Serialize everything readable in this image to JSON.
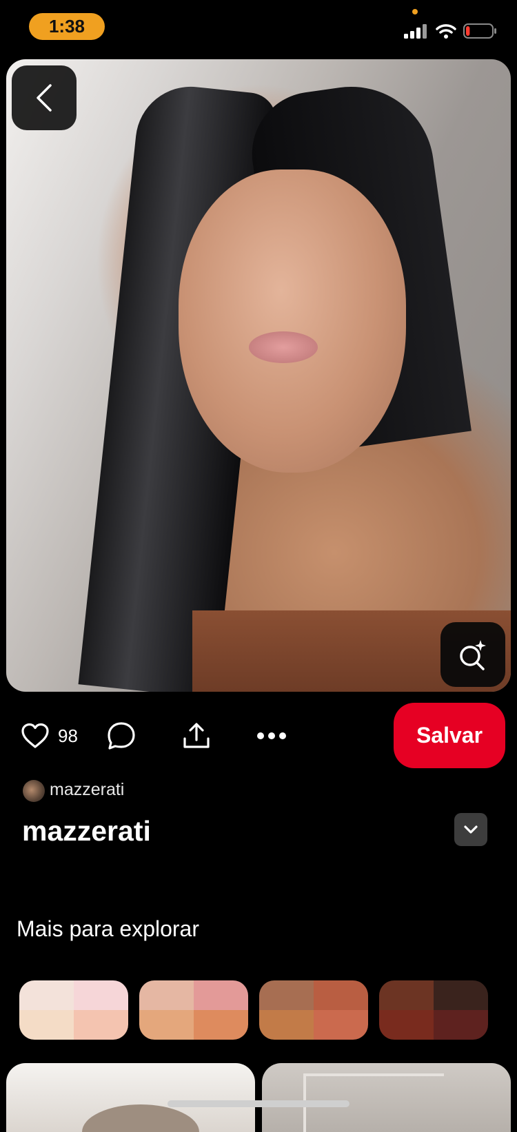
{
  "status_bar": {
    "time": "1:38",
    "battery_level_percent": 15
  },
  "pin": {
    "like_count": "98",
    "save_label": "Salvar",
    "author_small": "mazzerati",
    "title": "mazzerati"
  },
  "icons": {
    "back": "chevron-left-icon",
    "visual_search": "lens-sparkle-icon",
    "like": "heart-outline-icon",
    "comment": "comment-bubble-icon",
    "share": "share-upload-icon",
    "more": "ellipsis-icon",
    "expand": "chevron-down-icon"
  },
  "explore": {
    "title": "Mais para explorar",
    "palettes": [
      [
        "#f3e2da",
        "#f6d6d8",
        "#f4dcc6",
        "#f4c4b0"
      ],
      [
        "#e5b7a3",
        "#e39a98",
        "#e4a77c",
        "#de8b5e"
      ],
      [
        "#a76e52",
        "#b95e42",
        "#c27b48",
        "#cb6a4e"
      ],
      [
        "#6c3423",
        "#3a231d",
        "#792b1e",
        "#5e221f"
      ]
    ]
  },
  "colors": {
    "save_button": "#e60023",
    "time_pill": "#f0a020"
  }
}
